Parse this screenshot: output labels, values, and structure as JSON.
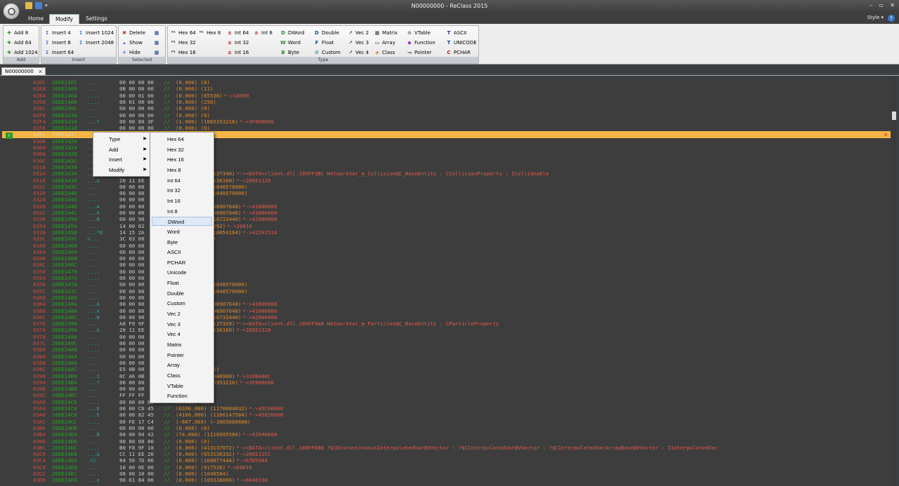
{
  "window": {
    "title": "N00000000 - ReClass 2015",
    "controls": [
      "–",
      "▫",
      "✕"
    ]
  },
  "tabs": [
    "Home",
    "Modify",
    "Settings"
  ],
  "style_label": "Style ▾",
  "help": "?",
  "ribbon": {
    "groups": [
      {
        "label": "Add",
        "buttons": [
          "Add 8",
          "Add 64",
          "Add 1024"
        ]
      },
      {
        "label": "Insert",
        "buttons": [
          "Insert 4",
          "Insert 8",
          "Insert 64",
          "Insert 1024",
          "Insert 2048"
        ]
      },
      {
        "label": "Selected",
        "buttons": [
          "Delete",
          "Show",
          "Hide"
        ]
      },
      {
        "label": "Type",
        "buttons": [
          "Hex 64",
          "Hex 32",
          "Hex 16",
          "Hex 8",
          "Int 64",
          "Int 32",
          "Int 16",
          "Int 8",
          "DWord",
          "Word",
          "Byte",
          "Double",
          "Float",
          "Custom",
          "Vec 2",
          "Vec 3",
          "Vec 4",
          "Matrix",
          "Array",
          "Class",
          "VTable",
          "Function",
          "Pointer",
          "ASCII",
          "UNICODE",
          "PCHAR"
        ]
      }
    ]
  },
  "doc_tab": "N00000000",
  "rows": [
    [
      "02DC",
      "26EE13FC",
      "....",
      "00 00 00 00",
      "//",
      "(0.000) (0)",
      ""
    ],
    [
      "02E0",
      "26EE1400",
      "....",
      "0B 00 00 00",
      "//",
      "(0.000) (11)",
      ""
    ],
    [
      "02E4",
      "26EE1404",
      "....",
      "00 00 01 00",
      "//",
      "(0.000) (65536)",
      "*->10000"
    ],
    [
      "02E8",
      "26EE1408",
      "....",
      "00 01 00 00",
      "//",
      "(0.000) (256)",
      ""
    ],
    [
      "02EC",
      "26EE140C",
      "....",
      "00 00 00 00",
      "//",
      "(0.000) (0)",
      ""
    ],
    [
      "02F0",
      "26EE1410",
      "....",
      "00 00 00 00",
      "//",
      "(0.000) (0)",
      ""
    ],
    [
      "02F4",
      "26EE1414",
      "...?",
      "00 00 80 3F",
      "//",
      "(1.000) (1065353216)",
      "*->3F800000"
    ],
    [
      "02F8",
      "26EE1418",
      "....",
      "00 00 00 00",
      "//",
      "(0.000) (0)",
      ""
    ],
    [
      "02FC",
      "26EE141C",
      "",
      "",
      "",
      "",
      ""
    ],
    [
      "0300",
      "26EE1420",
      "....",
      "",
      "",
      "",
      ""
    ],
    [
      "0304",
      "26EE1424",
      "....",
      "",
      "",
      "",
      ""
    ],
    [
      "0308",
      "26EE1428",
      "....",
      "",
      "",
      "",
      ""
    ],
    [
      "030C",
      "26EE142C",
      "....",
      "",
      "",
      "",
      ""
    ],
    [
      "0310",
      "26EE1430",
      "....",
      "",
      "",
      "",
      ""
    ],
    [
      "0314",
      "26EE1434",
      "....",
      "",
      "",
      "8137340)",
      "*-><DATA>client.dll.189FF9BC NetworkVar_m_Collision@C_BaseEntity : CCollisionProperty : ICollideable"
    ],
    [
      "0318",
      "26EE1438",
      "...&",
      "20 11 EE",
      "",
      "8136160)",
      "*->26EE1120"
    ],
    [
      "031C",
      "26EE143C",
      "....",
      "00 00 80",
      "",
      "-1048576000)",
      ""
    ],
    [
      "0320",
      "26EE1440",
      "....",
      "00 00 80",
      "",
      "-1048576000)",
      ""
    ],
    [
      "0324",
      "26EE1444",
      "....",
      "00 00 00",
      "",
      "",
      ""
    ],
    [
      "0328",
      "26EE1448",
      "...A",
      "00 00 80",
      "",
      "098907648)",
      "*->41800000"
    ],
    [
      "032C",
      "26EE144C",
      "...A",
      "00 00 80",
      "",
      "098907648)",
      "*->41800000"
    ],
    [
      "0330",
      "26EE1450",
      "...B",
      "00 00 90",
      "",
      "116733440)",
      "*->42900000"
    ],
    [
      "0334",
      "26EE1454",
      "....",
      "14 00 02",
      "",
      "1092)",
      "*->20014"
    ],
    [
      "0338",
      "26EE1458",
      "...*B",
      "14 15 2A",
      "",
      "110054164)",
      "*->422A1514"
    ],
    [
      "033C",
      "26EE145C",
      "<...",
      "3C 03 00",
      "",
      "8)",
      ""
    ],
    [
      "0340",
      "26EE1460",
      "....",
      "00 00 00",
      "",
      "",
      ""
    ],
    [
      "0344",
      "26EE1464",
      "....",
      "00 00 00",
      "",
      "",
      ""
    ],
    [
      "0348",
      "26EE1468",
      "....",
      "00 00 00",
      "",
      "",
      ""
    ],
    [
      "034C",
      "26EE146C",
      "....",
      "00 00 00",
      "",
      "",
      ""
    ],
    [
      "0350",
      "26EE1470",
      "....",
      "00 00 00",
      "",
      "",
      ""
    ],
    [
      "0354",
      "26EE1474",
      "....",
      "00 00 00",
      "",
      "",
      ""
    ],
    [
      "0358",
      "26EE1478",
      "....",
      "00 00 80",
      "",
      "-1048576000)",
      ""
    ],
    [
      "035C",
      "26EE147C",
      "....",
      "00 00 80",
      "",
      "-1048576000)",
      ""
    ],
    [
      "0360",
      "26EE1480",
      "....",
      "00 00 00",
      "",
      "",
      ""
    ],
    [
      "0364",
      "26EE1484",
      "...A",
      "00 00 80",
      "",
      "098907648)",
      "*->41800000"
    ],
    [
      "0368",
      "26EE1488",
      "...A",
      "00 00 80",
      "",
      "098907648)",
      "*->41800000"
    ],
    [
      "036C",
      "26EE148C",
      "...B",
      "00 00 90",
      "",
      "116733440)",
      "*->42900000"
    ],
    [
      "0370",
      "26EE1490",
      "....",
      "A8 F9 9F",
      "",
      "8137320)",
      "*-><DATA>client.dll.189FF9A8 NetworkVar_m_Particles@C_BaseEntity : CParticleProperty"
    ],
    [
      "0374",
      "26EE1494",
      "...&",
      "20 11 EE",
      "",
      "8136160)",
      "*->26EE1120"
    ],
    [
      "0378",
      "26EE1498",
      "....",
      "00 00 00",
      "",
      "",
      ""
    ],
    [
      "037C",
      "26EE149C",
      "....",
      "00 00 00",
      "",
      "",
      ""
    ],
    [
      "0380",
      "26EE14A0",
      "....",
      "00 00 00",
      "",
      "",
      ""
    ],
    [
      "0384",
      "26EE14A4",
      "....",
      "00 00 00",
      "",
      "",
      ""
    ],
    [
      "0388",
      "26EE14A8",
      "....",
      "00 00 00",
      "",
      "",
      ""
    ],
    [
      "038C",
      "26EE14AC",
      "....",
      "E5 0B 00",
      "",
      "05)",
      ""
    ],
    [
      "0390",
      "26EE14B0",
      "...1",
      "0C A6 0B",
      "",
      "2846988)",
      "*->310BA60C"
    ],
    [
      "0394",
      "26EE14B4",
      "...?",
      "00 00 80",
      "",
      "65353216)",
      "*->3F800000"
    ],
    [
      "0398",
      "26EE14B8",
      "....",
      "00 00 00",
      "",
      "",
      ""
    ],
    [
      "039C",
      "26EE14BC",
      "....",
      "FF FF FF",
      "",
      "",
      ""
    ],
    [
      "03A0",
      "26EE14C0",
      "....",
      "00 00 00 00",
      "//",
      "(0.000) (0)",
      ""
    ],
    [
      "03A4",
      "26EE14C4",
      "...E",
      "00 00 C6 45",
      "//",
      "(6336.000) (1170604032)",
      "*->45C60000"
    ],
    [
      "03A8",
      "26EE14C8",
      "...E",
      "00 00 82 45",
      "//",
      "(4160.000) (1166147584)",
      "*->45820000"
    ],
    [
      "03AC",
      "26EE14CC",
      "....",
      "00 FE 17 C4",
      "//",
      "(-607.969) (-1005060608)",
      ""
    ],
    [
      "03B0",
      "26EE14D0",
      "....",
      "00 00 00 00",
      "//",
      "(0.000) (0)",
      ""
    ],
    [
      "03B4",
      "26EE14D4",
      "...B",
      "00 00 94 42",
      "//",
      "(74.000) (1116995584)",
      "*->42940000"
    ],
    [
      "03B8",
      "26EE14D8",
      "....",
      "00 00 00 00",
      "//",
      "(0.000) (0)",
      ""
    ],
    [
      "03BC",
      "26EE14DC",
      "....",
      "B0 F8 9F 18",
      "//",
      "(0.000) (413137072)",
      "*-><DATA>client.dll.189FF8B0 ?$CDiscontinuousInterpolatedVar@VVector : ?$CInterpolatedVar@VVector : ?$CInterpolatedVarArrayBase@VVector : IInterpolatedVar"
    ],
    [
      "03C0",
      "26EE14E0",
      "...&",
      "CC 11 EE 26",
      "//",
      "(0.000) (653136332)",
      "*->26EE11CC"
    ],
    [
      "03C4",
      "26EE14E4",
      ".V}.",
      "84 56 7D 06",
      "//",
      "(0.000) (108877444)",
      "*->67D5684"
    ],
    [
      "03C8",
      "26EE14E8",
      "....",
      "10 00 0E 00",
      "//",
      "(0.000) (917520)",
      "*->E0010"
    ],
    [
      "03CC",
      "26EE14EC",
      "....",
      "08 00 10 00",
      "//",
      "(0.000) (1048584)",
      ""
    ],
    [
      "03D0",
      "26EE14F0",
      "...a",
      "90 61 84 06",
      "//",
      "(0.000) (109338000)",
      "*->6846190"
    ]
  ],
  "context_menu": {
    "items": [
      "Type",
      "Add",
      "Insert",
      "Modify"
    ]
  },
  "type_submenu": {
    "items": [
      "Hex 64",
      "Hex 32",
      "Hex 16",
      "Hex 8",
      "Int 64",
      "Int 32",
      "Int 16",
      "Int 8",
      "DWord",
      "Word",
      "Byte",
      "ASCII",
      "PCHAR",
      "Unicode",
      "Float",
      "Double",
      "Custom",
      "Vec 2",
      "Vec 3",
      "Vec 4",
      "Matrix",
      "Pointer",
      "Array",
      "Class",
      "VTable",
      "Function"
    ],
    "highlighted": "DWord"
  }
}
